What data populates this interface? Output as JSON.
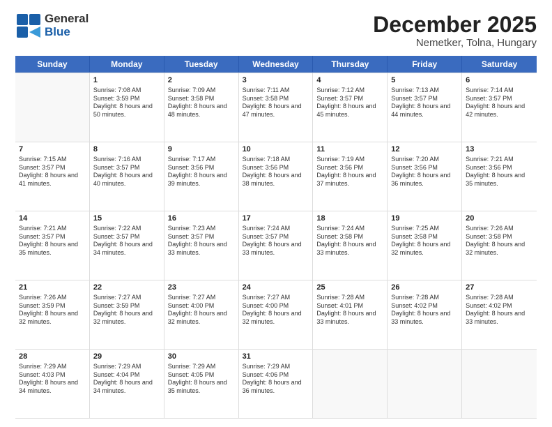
{
  "header": {
    "logo_line1": "General",
    "logo_line2": "Blue",
    "month": "December 2025",
    "location": "Nemetker, Tolna, Hungary"
  },
  "weekdays": [
    "Sunday",
    "Monday",
    "Tuesday",
    "Wednesday",
    "Thursday",
    "Friday",
    "Saturday"
  ],
  "rows": [
    [
      {
        "day": "",
        "sunrise": "",
        "sunset": "",
        "daylight": ""
      },
      {
        "day": "1",
        "sunrise": "Sunrise: 7:08 AM",
        "sunset": "Sunset: 3:59 PM",
        "daylight": "Daylight: 8 hours and 50 minutes."
      },
      {
        "day": "2",
        "sunrise": "Sunrise: 7:09 AM",
        "sunset": "Sunset: 3:58 PM",
        "daylight": "Daylight: 8 hours and 48 minutes."
      },
      {
        "day": "3",
        "sunrise": "Sunrise: 7:11 AM",
        "sunset": "Sunset: 3:58 PM",
        "daylight": "Daylight: 8 hours and 47 minutes."
      },
      {
        "day": "4",
        "sunrise": "Sunrise: 7:12 AM",
        "sunset": "Sunset: 3:57 PM",
        "daylight": "Daylight: 8 hours and 45 minutes."
      },
      {
        "day": "5",
        "sunrise": "Sunrise: 7:13 AM",
        "sunset": "Sunset: 3:57 PM",
        "daylight": "Daylight: 8 hours and 44 minutes."
      },
      {
        "day": "6",
        "sunrise": "Sunrise: 7:14 AM",
        "sunset": "Sunset: 3:57 PM",
        "daylight": "Daylight: 8 hours and 42 minutes."
      }
    ],
    [
      {
        "day": "7",
        "sunrise": "Sunrise: 7:15 AM",
        "sunset": "Sunset: 3:57 PM",
        "daylight": "Daylight: 8 hours and 41 minutes."
      },
      {
        "day": "8",
        "sunrise": "Sunrise: 7:16 AM",
        "sunset": "Sunset: 3:57 PM",
        "daylight": "Daylight: 8 hours and 40 minutes."
      },
      {
        "day": "9",
        "sunrise": "Sunrise: 7:17 AM",
        "sunset": "Sunset: 3:56 PM",
        "daylight": "Daylight: 8 hours and 39 minutes."
      },
      {
        "day": "10",
        "sunrise": "Sunrise: 7:18 AM",
        "sunset": "Sunset: 3:56 PM",
        "daylight": "Daylight: 8 hours and 38 minutes."
      },
      {
        "day": "11",
        "sunrise": "Sunrise: 7:19 AM",
        "sunset": "Sunset: 3:56 PM",
        "daylight": "Daylight: 8 hours and 37 minutes."
      },
      {
        "day": "12",
        "sunrise": "Sunrise: 7:20 AM",
        "sunset": "Sunset: 3:56 PM",
        "daylight": "Daylight: 8 hours and 36 minutes."
      },
      {
        "day": "13",
        "sunrise": "Sunrise: 7:21 AM",
        "sunset": "Sunset: 3:56 PM",
        "daylight": "Daylight: 8 hours and 35 minutes."
      }
    ],
    [
      {
        "day": "14",
        "sunrise": "Sunrise: 7:21 AM",
        "sunset": "Sunset: 3:57 PM",
        "daylight": "Daylight: 8 hours and 35 minutes."
      },
      {
        "day": "15",
        "sunrise": "Sunrise: 7:22 AM",
        "sunset": "Sunset: 3:57 PM",
        "daylight": "Daylight: 8 hours and 34 minutes."
      },
      {
        "day": "16",
        "sunrise": "Sunrise: 7:23 AM",
        "sunset": "Sunset: 3:57 PM",
        "daylight": "Daylight: 8 hours and 33 minutes."
      },
      {
        "day": "17",
        "sunrise": "Sunrise: 7:24 AM",
        "sunset": "Sunset: 3:57 PM",
        "daylight": "Daylight: 8 hours and 33 minutes."
      },
      {
        "day": "18",
        "sunrise": "Sunrise: 7:24 AM",
        "sunset": "Sunset: 3:58 PM",
        "daylight": "Daylight: 8 hours and 33 minutes."
      },
      {
        "day": "19",
        "sunrise": "Sunrise: 7:25 AM",
        "sunset": "Sunset: 3:58 PM",
        "daylight": "Daylight: 8 hours and 32 minutes."
      },
      {
        "day": "20",
        "sunrise": "Sunrise: 7:26 AM",
        "sunset": "Sunset: 3:58 PM",
        "daylight": "Daylight: 8 hours and 32 minutes."
      }
    ],
    [
      {
        "day": "21",
        "sunrise": "Sunrise: 7:26 AM",
        "sunset": "Sunset: 3:59 PM",
        "daylight": "Daylight: 8 hours and 32 minutes."
      },
      {
        "day": "22",
        "sunrise": "Sunrise: 7:27 AM",
        "sunset": "Sunset: 3:59 PM",
        "daylight": "Daylight: 8 hours and 32 minutes."
      },
      {
        "day": "23",
        "sunrise": "Sunrise: 7:27 AM",
        "sunset": "Sunset: 4:00 PM",
        "daylight": "Daylight: 8 hours and 32 minutes."
      },
      {
        "day": "24",
        "sunrise": "Sunrise: 7:27 AM",
        "sunset": "Sunset: 4:00 PM",
        "daylight": "Daylight: 8 hours and 32 minutes."
      },
      {
        "day": "25",
        "sunrise": "Sunrise: 7:28 AM",
        "sunset": "Sunset: 4:01 PM",
        "daylight": "Daylight: 8 hours and 33 minutes."
      },
      {
        "day": "26",
        "sunrise": "Sunrise: 7:28 AM",
        "sunset": "Sunset: 4:02 PM",
        "daylight": "Daylight: 8 hours and 33 minutes."
      },
      {
        "day": "27",
        "sunrise": "Sunrise: 7:28 AM",
        "sunset": "Sunset: 4:02 PM",
        "daylight": "Daylight: 8 hours and 33 minutes."
      }
    ],
    [
      {
        "day": "28",
        "sunrise": "Sunrise: 7:29 AM",
        "sunset": "Sunset: 4:03 PM",
        "daylight": "Daylight: 8 hours and 34 minutes."
      },
      {
        "day": "29",
        "sunrise": "Sunrise: 7:29 AM",
        "sunset": "Sunset: 4:04 PM",
        "daylight": "Daylight: 8 hours and 34 minutes."
      },
      {
        "day": "30",
        "sunrise": "Sunrise: 7:29 AM",
        "sunset": "Sunset: 4:05 PM",
        "daylight": "Daylight: 8 hours and 35 minutes."
      },
      {
        "day": "31",
        "sunrise": "Sunrise: 7:29 AM",
        "sunset": "Sunset: 4:06 PM",
        "daylight": "Daylight: 8 hours and 36 minutes."
      },
      {
        "day": "",
        "sunrise": "",
        "sunset": "",
        "daylight": ""
      },
      {
        "day": "",
        "sunrise": "",
        "sunset": "",
        "daylight": ""
      },
      {
        "day": "",
        "sunrise": "",
        "sunset": "",
        "daylight": ""
      }
    ]
  ]
}
